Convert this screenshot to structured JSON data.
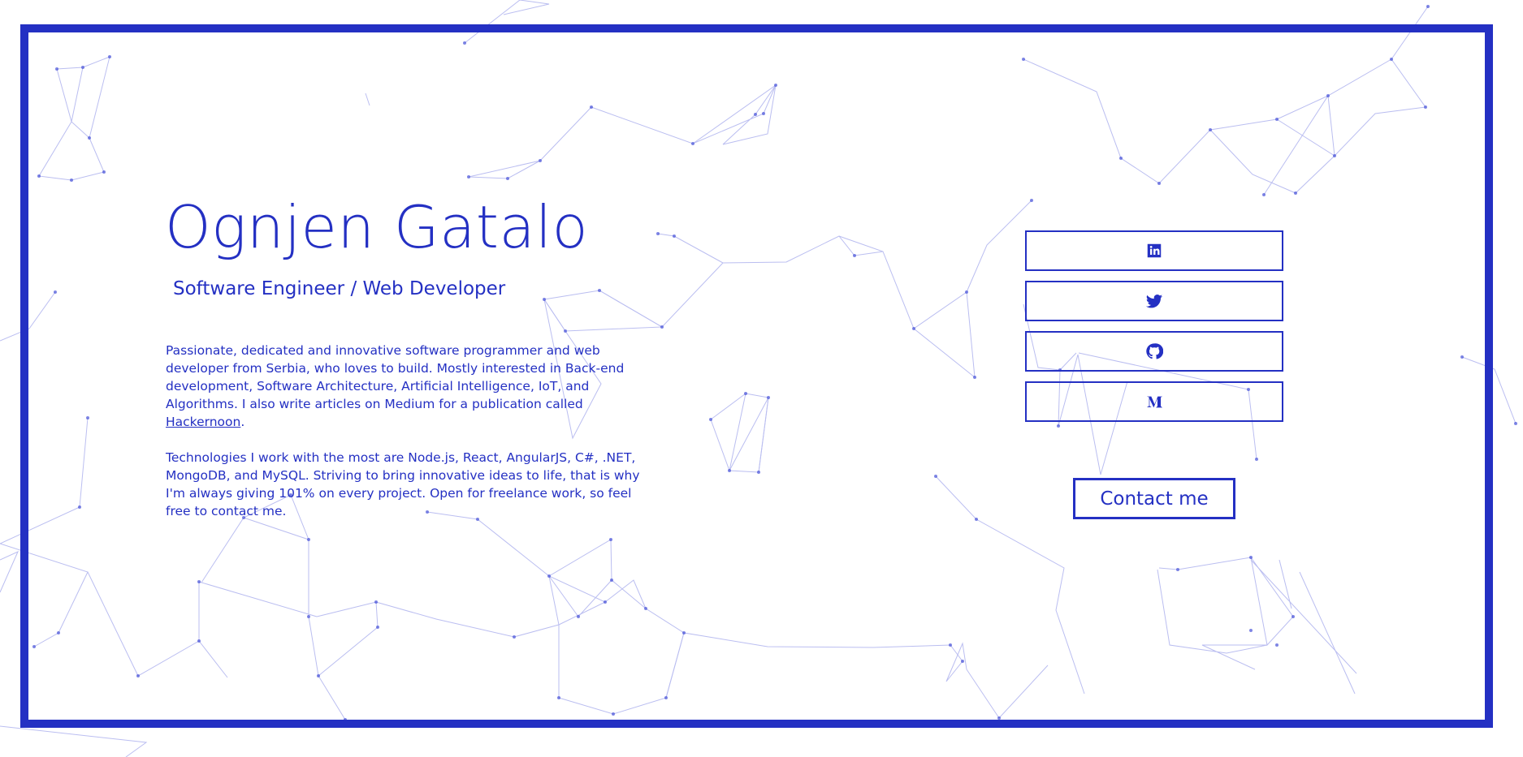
{
  "hero": {
    "name": "Ognjen Gatalo",
    "role": "Software Engineer / Web Developer"
  },
  "bio": {
    "paragraph1_text": "Passionate, dedicated and innovative software programmer and web developer from Serbia, who loves to build. Mostly interested in Back-end development, Software Architecture, Artificial Intelligence, IoT, and Algorithms. I also write articles on Medium for a publication called ",
    "paragraph1_link": "Hackernoon",
    "paragraph1_end": ".",
    "paragraph2": "Technologies I work with the most are Node.js, React, AngularJS, C#, .NET, MongoDB, and MySQL. Striving to bring innovative ideas to life, that is why I'm always giving 101% on every project. Open for freelance work, so feel free to contact me."
  },
  "social": [
    {
      "icon": "linkedin-icon"
    },
    {
      "icon": "twitter-icon"
    },
    {
      "icon": "github-icon"
    },
    {
      "icon": "medium-icon"
    }
  ],
  "contact": {
    "label": "Contact me"
  },
  "colors": {
    "accent": "#2430c3",
    "background": "#ffffff"
  }
}
